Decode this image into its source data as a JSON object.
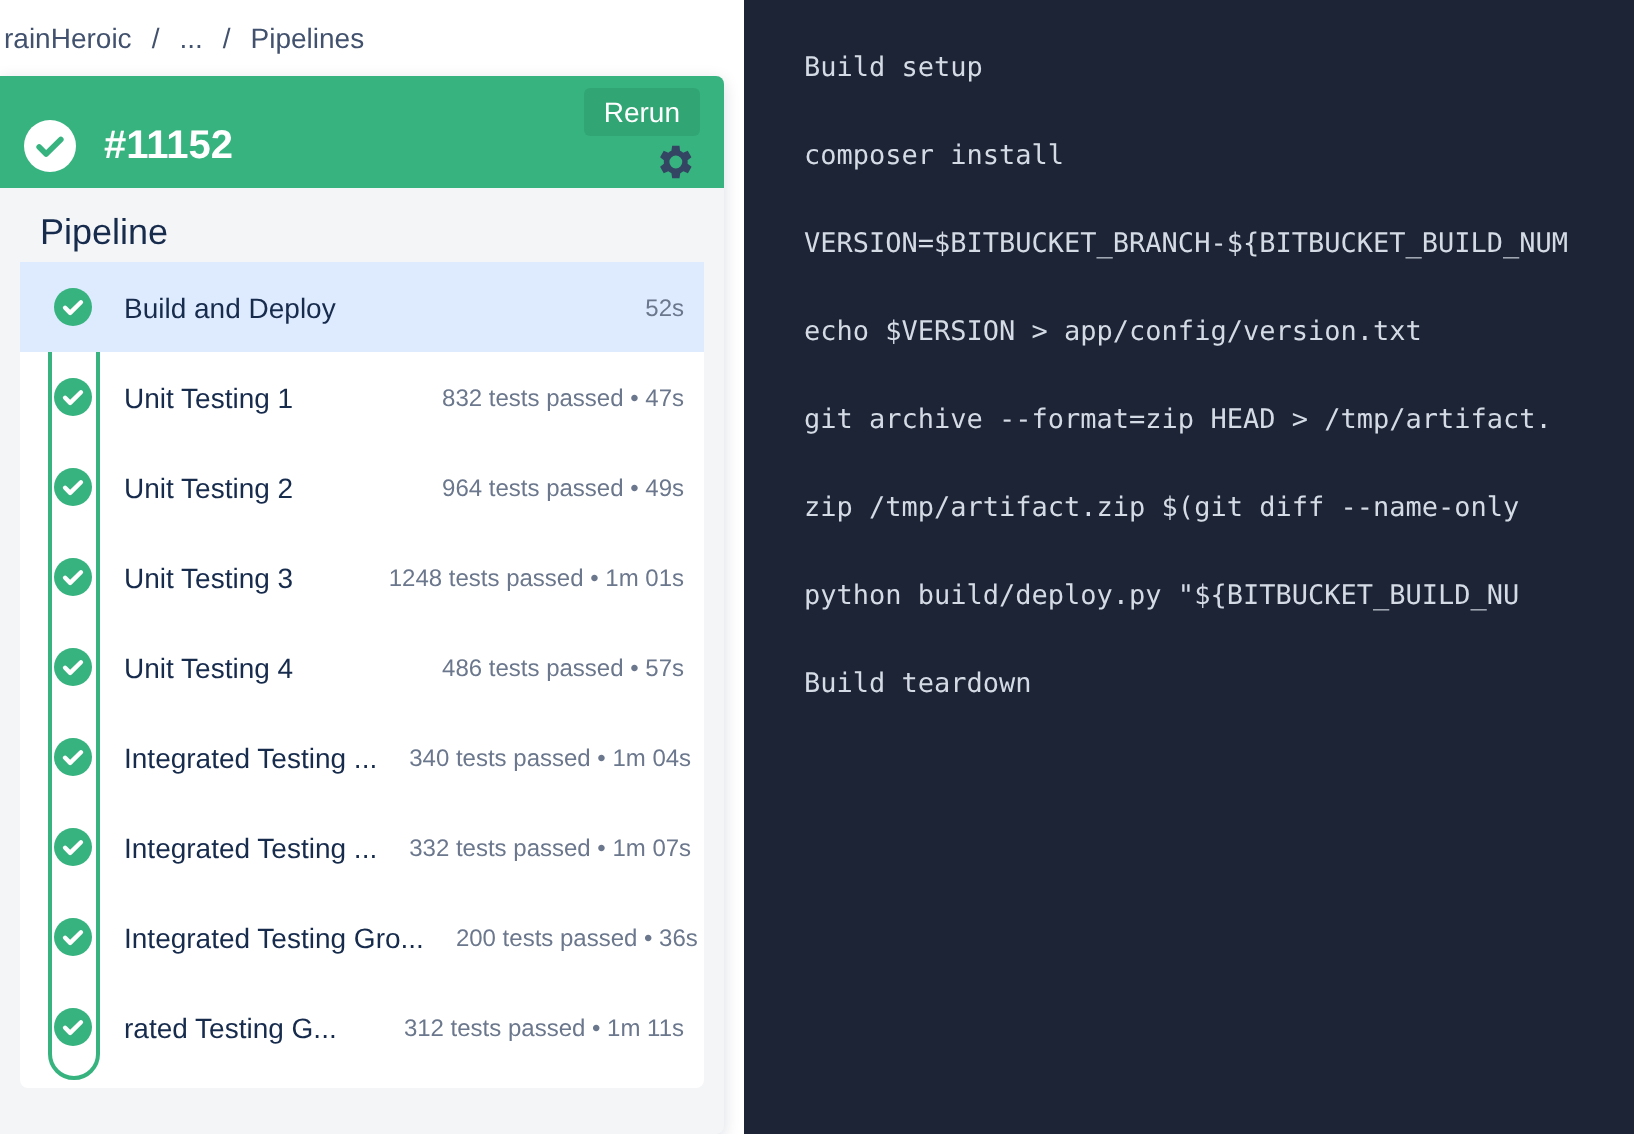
{
  "breadcrumb": {
    "items": [
      "rainHeroic",
      "...",
      "Pipelines"
    ],
    "separator": "/"
  },
  "header": {
    "build": "#11152",
    "rerun": "Rerun"
  },
  "pipeline": {
    "title": "Pipeline",
    "steps": [
      {
        "name": "Build and Deploy",
        "summary": "52s",
        "selected": true
      },
      {
        "name": "Unit Testing 1",
        "summary": "832 tests passed • 47s",
        "selected": false
      },
      {
        "name": "Unit Testing 2",
        "summary": "964 tests passed • 49s",
        "selected": false
      },
      {
        "name": "Unit Testing 3",
        "summary": "1248 tests passed • 1m 01s",
        "selected": false
      },
      {
        "name": "Unit Testing 4",
        "summary": "486 tests passed • 57s",
        "selected": false
      },
      {
        "name": "Integrated Testing ...",
        "summary": "340 tests passed • 1m 04s",
        "selected": false
      },
      {
        "name": "Integrated Testing ...",
        "summary": "332 tests passed • 1m 07s",
        "selected": false
      },
      {
        "name": "Integrated Testing Gro...",
        "summary": "200 tests passed • 36s",
        "selected": false
      },
      {
        "name": "rated Testing G...",
        "summary": "312 tests passed • 1m 11s",
        "selected": false
      }
    ]
  },
  "log": {
    "lines": [
      "Build setup",
      "composer install",
      "VERSION=$BITBUCKET_BRANCH-${BITBUCKET_BUILD_NUM",
      "echo $VERSION > app/config/version.txt",
      "git archive --format=zip HEAD > /tmp/artifact.",
      "zip /tmp/artifact.zip $(git diff --name-only",
      "python build/deploy.py \"${BITBUCKET_BUILD_NU",
      "Build teardown"
    ]
  }
}
